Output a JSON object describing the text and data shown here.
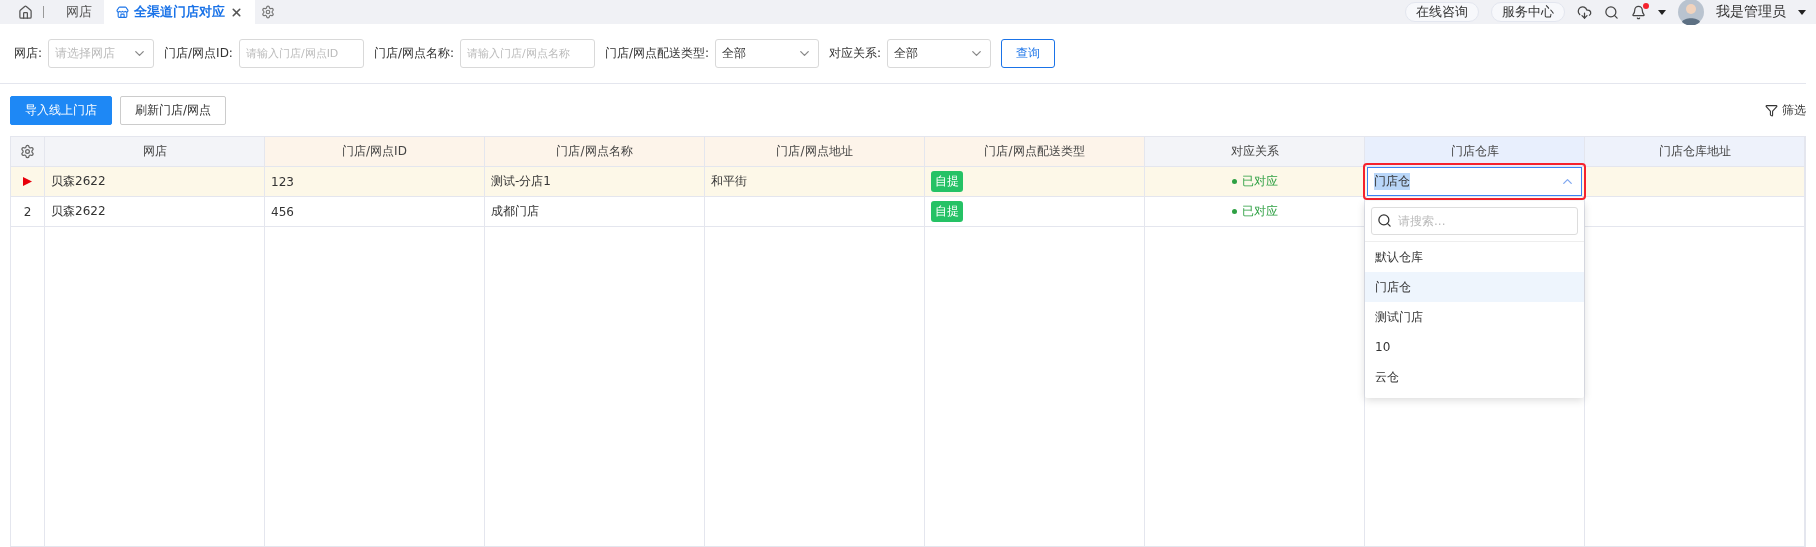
{
  "top_bar": {
    "tabs": [
      {
        "label": "网店",
        "selected": false,
        "closable": false
      },
      {
        "label": "全渠道门店对应",
        "selected": true,
        "closable": true
      }
    ],
    "pills": [
      "在线咨询",
      "服务中心"
    ],
    "notification": {
      "unread": true
    },
    "user": {
      "name": "我是管理员"
    }
  },
  "filters": [
    {
      "kind": "select",
      "label": "网店:",
      "placeholder": "请选择网店"
    },
    {
      "kind": "input",
      "label": "门店/网点ID:",
      "placeholder": "请输入门店/网点ID"
    },
    {
      "kind": "input",
      "label": "门店/网点名称:",
      "placeholder": "请输入门店/网点名称"
    },
    {
      "kind": "select",
      "label": "门店/网点配送类型:",
      "value": "全部"
    },
    {
      "kind": "select",
      "label": "对应关系:",
      "value": "全部"
    }
  ],
  "query_button": "查询",
  "actions": [
    {
      "label": "导入线上门店",
      "primary": true
    },
    {
      "label": "刷新门店/网点",
      "primary": false
    }
  ],
  "filter_link": "筛选",
  "table": {
    "columns": [
      {
        "label": "网店"
      },
      {
        "label": "门店/网点ID"
      },
      {
        "label": "门店/网点名称"
      },
      {
        "label": "门店/网点地址"
      },
      {
        "label": "门店/网点配送类型"
      },
      {
        "label": "对应关系"
      },
      {
        "label": "门店仓库"
      },
      {
        "label": "门店仓库地址"
      }
    ],
    "rows": [
      {
        "current": true,
        "shop": "贝森2622",
        "id": "123",
        "name": "测试-分店1",
        "address": "和平街",
        "delivery_type": "自提",
        "relation": "已对应",
        "warehouse": {
          "value": "门店仓",
          "open": true,
          "highlighted": true
        }
      },
      {
        "current": false,
        "index": "2",
        "shop": "贝森2622",
        "id": "456",
        "name": "成都门店",
        "delivery_type": "自提",
        "relation": "已对应"
      }
    ]
  },
  "warehouse_dropdown": {
    "search_placeholder": "请搜索...",
    "options": [
      {
        "label": "默认仓库",
        "selected": false
      },
      {
        "label": "门店仓",
        "selected": true
      },
      {
        "label": "测试门店",
        "selected": false
      },
      {
        "label": "10",
        "selected": false
      },
      {
        "label": "云仓",
        "selected": false
      }
    ]
  }
}
